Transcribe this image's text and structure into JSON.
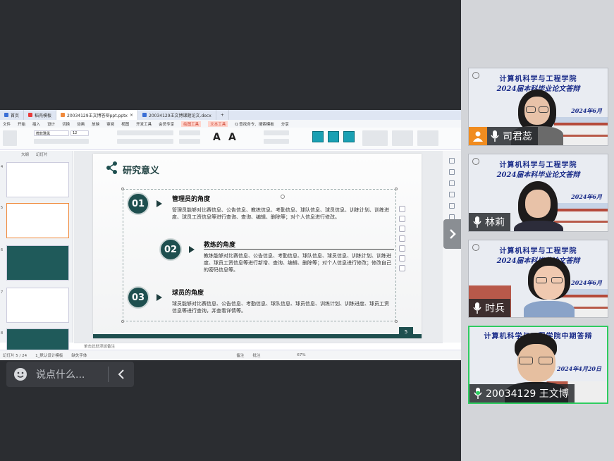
{
  "app": {
    "tabs": [
      {
        "label": "首页",
        "color": "#3b6fd6"
      },
      {
        "label": "稻壳模板",
        "color": "#e83b3b"
      },
      {
        "label": "20034129王文博答辩ppt.pptx",
        "color": "#f08a3c"
      },
      {
        "label": "20034129王文博课题论文.docx",
        "color": "#3b6fd6"
      }
    ],
    "ribbon_tabs": [
      "文件",
      "开始",
      "插入",
      "设计",
      "切换",
      "动画",
      "放映",
      "审阅",
      "视图",
      "开发工具",
      "会员专享",
      "绘图工具",
      "文本工具",
      "Q 查找命令、搜索模板",
      "分享",
      "未同步"
    ],
    "ribbon_highlight_1": "绘图工具",
    "ribbon_highlight_2": "文本工具",
    "font_name": "微软雅黑",
    "font_size": "12",
    "bigA_label": "A",
    "left_pane_tabs": [
      "大纲",
      "幻灯片"
    ],
    "slide_numbers": [
      "4",
      "5",
      "6",
      "7",
      "8"
    ],
    "notes_placeholder": "单击此处添加备注",
    "status": {
      "slide_count": "幻灯片 5 / 24",
      "theme": "1_默认设计模板",
      "font_missing": "缺失字体",
      "notes_label": "备注",
      "comment_label": "批注",
      "zoom": "67%"
    }
  },
  "slide": {
    "title": "研究意义",
    "page_number": "5",
    "sections": [
      {
        "num": "01",
        "title": "管理员的角度",
        "text": "管理员能够对比赛信息、公告信息、教练信息、考勤信息、球队信息、球员信息、训练计划、训练进度、球员工资信息等进行查询、查询、编辑、删除等；对个人信息进行修改。"
      },
      {
        "num": "02",
        "title": "教练的角度",
        "text": "教练能够对比赛信息、公告信息、考勤信息、球队信息、球员信息、训练计划、训练进度、球员工资信息等进行新增、查询、编辑、删除等；对个人信息进行修改；修改自己的密码信息等。"
      },
      {
        "num": "03",
        "title": "球员的角度",
        "text": "球员能够对比赛信息、公告信息、考勤信息、球队信息、球员信息、训练计划、训练进度、球员工资信息等进行查询，并查看详情等。"
      }
    ]
  },
  "chat": {
    "placeholder": "说点什么..."
  },
  "participants": [
    {
      "name": "司君蕊",
      "banner_line1": "计算机科学与工程学院",
      "banner_line2": "2024届本科毕业论文答辩",
      "date": "2024年6月",
      "mic": "on",
      "has_avatar_icon": true
    },
    {
      "name": "林莉",
      "banner_line1": "计算机科学与工程学院",
      "banner_line2": "2024届本科毕业论文答辩",
      "date": "2024年6月",
      "mic": "on",
      "has_avatar_icon": false
    },
    {
      "name": "时兵",
      "banner_line1": "计算机科学与工程学院",
      "banner_line2": "2024届本科毕业论文答辩",
      "date": "2024年6月",
      "mic": "on",
      "has_avatar_icon": false
    },
    {
      "name": "20034129 王文博",
      "banner_line1": "计算机科学与工程学院中期答辩",
      "banner_line2": "",
      "date": "2024年4月20日",
      "mic": "speaking",
      "has_avatar_icon": false
    }
  ],
  "colors": {
    "slide_teal": "#1e4f4f",
    "active_speaker": "#2ecc60",
    "banner_text": "#1b2d8a",
    "avatar_orange": "#f08c20"
  }
}
